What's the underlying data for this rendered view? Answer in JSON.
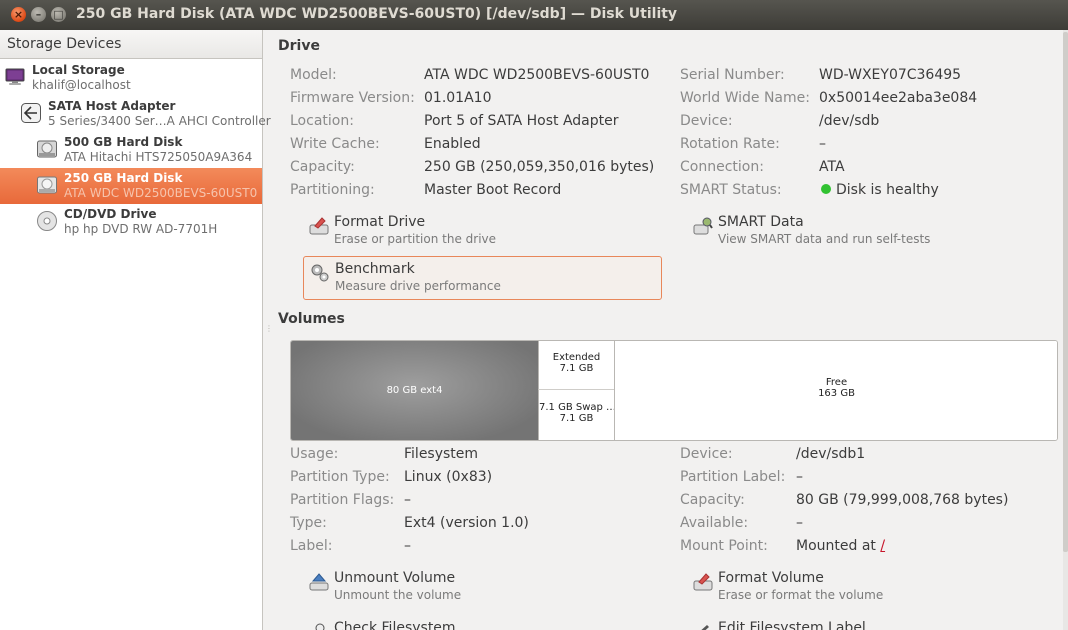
{
  "window": {
    "title": "250 GB Hard Disk (ATA WDC WD2500BEVS-60UST0) [/dev/sdb] — Disk Utility",
    "close_glyph": "×",
    "min_glyph": "–",
    "max_glyph": "□"
  },
  "sidebar": {
    "header": "Storage Devices",
    "items": [
      {
        "title": "Local Storage",
        "subtitle": "khalif@localhost",
        "icon": "computer-icon"
      },
      {
        "title": "SATA Host Adapter",
        "subtitle": "5 Series/3400 Ser…A AHCI Controller",
        "icon": "host-adapter-icon"
      },
      {
        "title": "500 GB Hard Disk",
        "subtitle": "ATA Hitachi HTS725050A9A364",
        "icon": "hard-disk-icon"
      },
      {
        "title": "250 GB Hard Disk",
        "subtitle": "ATA WDC WD2500BEVS-60UST0",
        "icon": "hard-disk-icon",
        "selected": true
      },
      {
        "title": "CD/DVD Drive",
        "subtitle": "hp hp     DVD RW AD-7701H",
        "icon": "optical-drive-icon"
      }
    ]
  },
  "drive": {
    "section_title": "Drive",
    "left": [
      {
        "label": "Model:",
        "value": "ATA WDC WD2500BEVS-60UST0"
      },
      {
        "label": "Firmware Version:",
        "value": "01.01A10"
      },
      {
        "label": "Location:",
        "value": "Port 5 of SATA Host Adapter"
      },
      {
        "label": "Write Cache:",
        "value": "Enabled"
      },
      {
        "label": "Capacity:",
        "value": "250 GB (250,059,350,016 bytes)"
      },
      {
        "label": "Partitioning:",
        "value": "Master Boot Record"
      }
    ],
    "right": [
      {
        "label": "Serial Number:",
        "value": "WD-WXEY07C36495"
      },
      {
        "label": "World Wide Name:",
        "value": "0x50014ee2aba3e084"
      },
      {
        "label": "Device:",
        "value": "/dev/sdb"
      },
      {
        "label": "Rotation Rate:",
        "value": "–"
      },
      {
        "label": "Connection:",
        "value": "ATA"
      },
      {
        "label": "SMART Status:",
        "value": "Disk is healthy"
      }
    ],
    "smart_color": "#31c231",
    "actions": {
      "format_drive": {
        "title": "Format Drive",
        "subtitle": "Erase or partition the drive"
      },
      "smart_data": {
        "title": "SMART Data",
        "subtitle": "View SMART data and run self-tests"
      },
      "benchmark": {
        "title": "Benchmark",
        "subtitle": "Measure drive performance"
      }
    }
  },
  "volumes": {
    "section_title": "Volumes",
    "bar": {
      "main": "80 GB ext4",
      "extended_name": "Extended",
      "extended_size": "7.1 GB",
      "swap_name": "7.1 GB Swap …",
      "swap_size": "7.1 GB",
      "free_name": "Free",
      "free_size": "163 GB"
    },
    "left": [
      {
        "label": "Usage:",
        "value": "Filesystem"
      },
      {
        "label": "Partition Type:",
        "value": "Linux (0x83)"
      },
      {
        "label": "Partition Flags:",
        "value": "–"
      },
      {
        "label": "Type:",
        "value": "Ext4 (version 1.0)"
      },
      {
        "label": "Label:",
        "value": "–"
      }
    ],
    "right": [
      {
        "label": "Device:",
        "value": "/dev/sdb1"
      },
      {
        "label": "Partition Label:",
        "value": "–"
      },
      {
        "label": "Capacity:",
        "value": "80 GB (79,999,008,768 bytes)"
      },
      {
        "label": "Available:",
        "value": "–"
      },
      {
        "label": "Mount Point:",
        "value": "Mounted at ",
        "link": "/"
      }
    ],
    "actions": {
      "unmount": {
        "title": "Unmount Volume",
        "subtitle": "Unmount the volume"
      },
      "format_volume": {
        "title": "Format Volume",
        "subtitle": "Erase or format the volume"
      },
      "check_fs": {
        "title": "Check Filesystem"
      },
      "edit_label": {
        "title": "Edit Filesystem Label"
      }
    }
  },
  "colors": {
    "accent": "#e8693a",
    "titlebar": "#3d3c37"
  }
}
